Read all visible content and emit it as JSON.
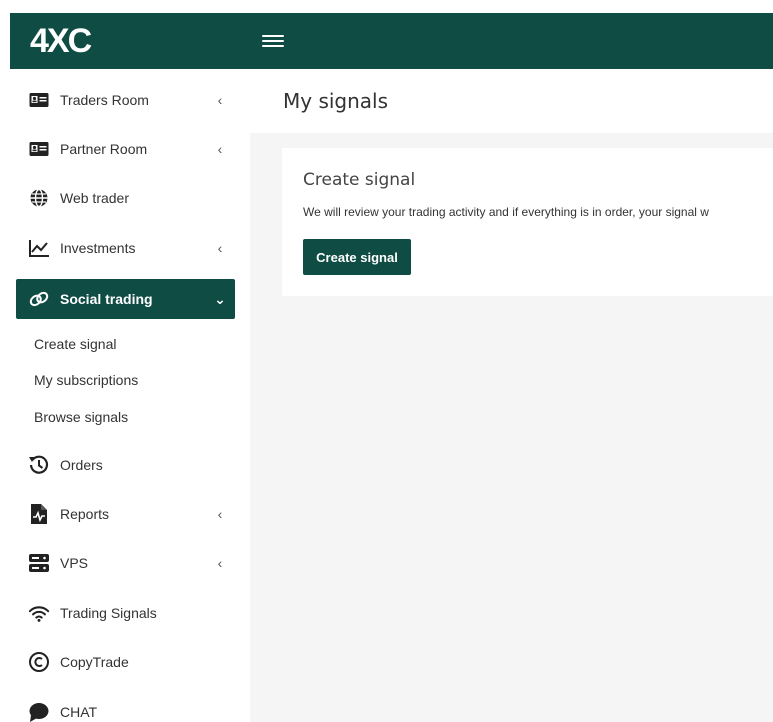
{
  "header": {
    "logo_text_pre": "4",
    "logo_text_x": "X",
    "logo_text_post": "C"
  },
  "sidebar": {
    "items": [
      {
        "label": "Traders Room",
        "icon": "id-card-icon",
        "chevron": "‹"
      },
      {
        "label": "Partner Room",
        "icon": "id-card-icon",
        "chevron": "‹"
      },
      {
        "label": "Web trader",
        "icon": "globe-icon"
      },
      {
        "label": "Investments",
        "icon": "chart-line-icon",
        "chevron": "‹"
      },
      {
        "label": "Social trading",
        "icon": "link-icon",
        "chevron": "⌄",
        "active": true
      },
      {
        "label": "Orders",
        "icon": "history-icon"
      },
      {
        "label": "Reports",
        "icon": "file-chart-icon",
        "chevron": "‹"
      },
      {
        "label": "VPS",
        "icon": "server-icon",
        "chevron": "‹"
      },
      {
        "label": "Trading Signals",
        "icon": "wifi-icon"
      },
      {
        "label": "CopyTrade",
        "icon": "copyright-icon"
      },
      {
        "label": "CHAT",
        "icon": "chat-icon"
      }
    ],
    "sub_items": [
      "Create signal",
      "My subscriptions",
      "Browse signals"
    ]
  },
  "main": {
    "title": "My signals",
    "card": {
      "title": "Create signal",
      "description": "We will review your trading activity and if everything is in order, your signal w",
      "button_label": "Create signal"
    }
  },
  "colors": {
    "brand": "#0f4c44",
    "background": "#f5f5f5"
  }
}
